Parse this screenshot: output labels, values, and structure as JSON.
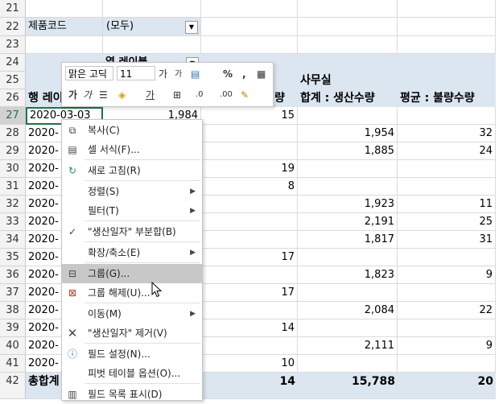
{
  "rows": [
    {
      "num": "21",
      "a": "",
      "b": "",
      "c": "",
      "d": "",
      "e": ""
    },
    {
      "num": "22",
      "a": "제품코드",
      "b": "(모두)",
      "c": "",
      "d": "",
      "e": ""
    },
    {
      "num": "23",
      "a": "",
      "b": "",
      "c": "",
      "d": "",
      "e": ""
    },
    {
      "num": "24",
      "a": "",
      "b": "열 레이블",
      "c": "",
      "d": "",
      "e": ""
    },
    {
      "num": "25",
      "a": "",
      "b": "",
      "c": "",
      "d": "사무실",
      "e": ""
    },
    {
      "num": "26",
      "a": "행 레이블",
      "b": "",
      "c": "량",
      "d": "합계 : 생산수량",
      "e": "평균 : 불량수량"
    },
    {
      "num": "27",
      "a": "2020-03-03",
      "b": "1,984",
      "c": "15",
      "d": "",
      "e": ""
    },
    {
      "num": "28",
      "a": "2020-",
      "b": "",
      "c": "",
      "d": "1,954",
      "e": "32"
    },
    {
      "num": "29",
      "a": "2020-",
      "b": "",
      "c": "",
      "d": "1,885",
      "e": "24"
    },
    {
      "num": "30",
      "a": "2020-",
      "b": "",
      "c": "19",
      "d": "",
      "e": ""
    },
    {
      "num": "31",
      "a": "2020-",
      "b": "",
      "c": "8",
      "d": "",
      "e": ""
    },
    {
      "num": "32",
      "a": "2020-",
      "b": "",
      "c": "",
      "d": "1,923",
      "e": "11"
    },
    {
      "num": "33",
      "a": "2020-",
      "b": "",
      "c": "",
      "d": "2,191",
      "e": "25"
    },
    {
      "num": "34",
      "a": "2020-",
      "b": "",
      "c": "",
      "d": "1,817",
      "e": "31"
    },
    {
      "num": "35",
      "a": "2020-",
      "b": "",
      "c": "17",
      "d": "",
      "e": ""
    },
    {
      "num": "36",
      "a": "2020-",
      "b": "",
      "c": "",
      "d": "1,823",
      "e": "9"
    },
    {
      "num": "37",
      "a": "2020-",
      "b": "",
      "c": "17",
      "d": "",
      "e": ""
    },
    {
      "num": "38",
      "a": "2020-",
      "b": "",
      "c": "",
      "d": "2,084",
      "e": "22"
    },
    {
      "num": "39",
      "a": "2020-",
      "b": "",
      "c": "14",
      "d": "",
      "e": ""
    },
    {
      "num": "40",
      "a": "2020-",
      "b": "",
      "c": "",
      "d": "2,111",
      "e": "9"
    },
    {
      "num": "41",
      "a": "2020-",
      "b": "",
      "c": "10",
      "d": "",
      "e": ""
    },
    {
      "num": "42",
      "a": "총합계",
      "b": "",
      "c": "14",
      "d": "15,788",
      "e": "20"
    }
  ],
  "mini_toolbar": {
    "font_name": "맑은 고딕",
    "font_size": "11",
    "grow": "가",
    "shrink": "가",
    "percent": "%",
    "comma": ",",
    "bold": "가",
    "italic": "가",
    "dec_inc": ".0",
    "dec_dec": ".00"
  },
  "context_menu": [
    {
      "label": "복사(C)",
      "icon": "copy-icon"
    },
    {
      "label": "셀 서식(F)...",
      "icon": "format-cells-icon"
    },
    {
      "label": "새로 고침(R)",
      "icon": "refresh-icon"
    },
    {
      "label": "정렬(S)",
      "icon": "",
      "arrow": true
    },
    {
      "label": "필터(T)",
      "icon": "",
      "arrow": true
    },
    {
      "label": "\"생산일자\" 부분합(B)",
      "icon": "check-icon"
    },
    {
      "label": "확장/축소(E)",
      "icon": "",
      "arrow": true
    },
    {
      "label": "그룹(G)...",
      "icon": "group-icon"
    },
    {
      "label": "그룹 해제(U)...",
      "icon": "ungroup-icon"
    },
    {
      "label": "이동(M)",
      "icon": "",
      "arrow": true
    },
    {
      "label": "\"생산일자\" 제거(V)",
      "icon": "remove-icon"
    },
    {
      "label": "필드 설정(N)...",
      "icon": "field-settings-icon"
    },
    {
      "label": "피벗 테이블 옵션(O)...",
      "icon": ""
    },
    {
      "label": "필드 목록 표시(D)",
      "icon": "field-list-icon"
    }
  ]
}
